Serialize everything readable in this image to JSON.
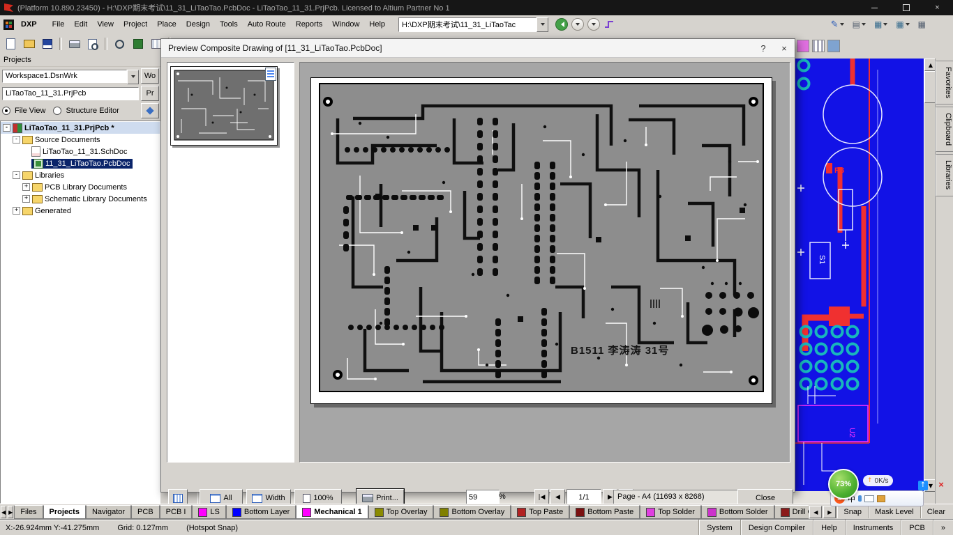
{
  "titlebar": {
    "title": "(Platform 10.890.23450) - H:\\DXP期末考试\\11_31_LiTaoTao.PcbDoc - LiTaoTao_11_31.PrjPcb. Licensed to Altium Partner No 1"
  },
  "menubar": {
    "brand": "DXP",
    "items": [
      "File",
      "Edit",
      "View",
      "Project",
      "Place",
      "Design",
      "Tools",
      "Auto Route",
      "Reports",
      "Window",
      "Help"
    ],
    "address": "H:\\DXP期末考试\\11_31_LiTaoTac"
  },
  "projects_panel": {
    "header": "Projects",
    "workspace_value": "Workspace1.DsnWrk",
    "workspace_button": "Wo",
    "project_value": "LiTaoTao_11_31.PrjPcb",
    "project_button": "Pr",
    "file_view": "File View",
    "structure_editor": "Structure Editor",
    "tree": [
      {
        "label": "LiTaoTao_11_31.PrjPcb *",
        "toggle": "-"
      },
      {
        "label": "Source Documents",
        "toggle": "-"
      },
      {
        "label": "LiTaoTao_11_31.SchDoc"
      },
      {
        "label": "11_31_LiTaoTao.PcbDoc"
      },
      {
        "label": "Libraries",
        "toggle": "-"
      },
      {
        "label": "PCB Library Documents",
        "toggle": "+"
      },
      {
        "label": "Schematic Library Documents",
        "toggle": "+"
      },
      {
        "label": "Generated",
        "toggle": "+"
      }
    ]
  },
  "dialog": {
    "title": "Preview Composite Drawing of [11_31_LiTaoTao.PcbDoc]",
    "all_button": "All",
    "width_button": "Width",
    "zoom100_button": "100%",
    "print_button": "Print...",
    "zoom_value": "59",
    "zoom_unit": "%",
    "page_current": "1/1",
    "page_info": "Page - A4 (11693 x 8268)",
    "close_button": "Close",
    "board_text": "B1511 李涛涛  31号"
  },
  "pcb_editor": {
    "designator_r3": "R3",
    "designator_s1": "S1",
    "designator_u2": "U2"
  },
  "right_tabs": [
    "Favorites",
    "Clipboard",
    "Libraries"
  ],
  "tabstrip": {
    "panel_tabs": [
      "Files",
      "Projects",
      "Navigator",
      "PCB",
      "PCB I"
    ],
    "layer_tabs": [
      {
        "label": "LS",
        "color": "#ff00ff"
      },
      {
        "label": "Bottom Layer",
        "color": "#0000ff"
      },
      {
        "label": "Mechanical 1",
        "color": "#ff00ff"
      },
      {
        "label": "Top Overlay",
        "color": "#8b8b00"
      },
      {
        "label": "Bottom Overlay",
        "color": "#808000"
      },
      {
        "label": "Top Paste",
        "color": "#b22222"
      },
      {
        "label": "Bottom Paste",
        "color": "#7a1010"
      },
      {
        "label": "Top Solder",
        "color": "#e040e0"
      },
      {
        "label": "Bottom Solder",
        "color": "#cc33cc"
      },
      {
        "label": "Drill Guide",
        "color": "#8b1a1a"
      }
    ],
    "active_layer": "Mechanical 1",
    "snap": "Snap",
    "mask_level": "Mask Level",
    "clear": "Clear"
  },
  "statusbar": {
    "coords": "X:-26.924mm Y:-41.275mm",
    "grid": "Grid: 0.127mm",
    "hotspot": "(Hotspot Snap)",
    "menus": [
      "System",
      "Design Compiler",
      "Help",
      "Instruments",
      "PCB"
    ],
    "overflow": "»"
  },
  "ime": {
    "logo": "S",
    "mode": "中"
  },
  "speedball": {
    "percent": "73%",
    "net_speed": "0K/s"
  },
  "icons": {
    "help": "?",
    "close": "×",
    "caret": "▼",
    "left": "◀",
    "right": "▶",
    "up": "▲",
    "down": "▼",
    "first": "|◀",
    "prev": "◀",
    "next": "▶",
    "last": "▶|"
  },
  "colors": {
    "selection": "#0a246a",
    "pcb_background": "#1212e6",
    "trace_red": "#f03030",
    "pad_teal": "#18b6bc",
    "silkscreen_magenta": "#ff30ff"
  }
}
